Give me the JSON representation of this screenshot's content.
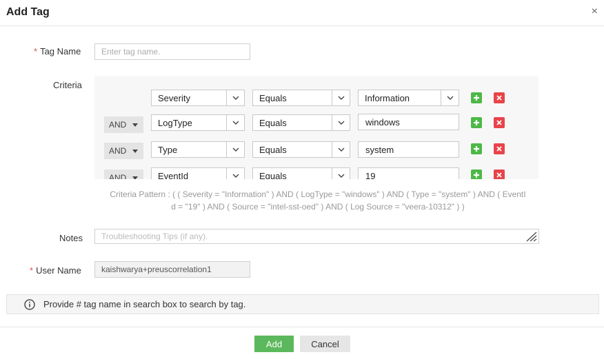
{
  "dialog": {
    "title": "Add Tag",
    "close_icon": "close-icon",
    "close_glyph": "×"
  },
  "tag_name": {
    "required_mark": "*",
    "label": "Tag Name",
    "placeholder": "Enter tag name."
  },
  "criteria": {
    "label": "Criteria",
    "rows": [
      {
        "connector": "",
        "field": "Severity",
        "operator": "Equals",
        "value": "Information",
        "value_type": "select"
      },
      {
        "connector": "AND",
        "field": "LogType",
        "operator": "Equals",
        "value": "windows",
        "value_type": "text"
      },
      {
        "connector": "AND",
        "field": "Type",
        "operator": "Equals",
        "value": "system",
        "value_type": "text"
      },
      {
        "connector": "AND",
        "field": "EventId",
        "operator": "Equals",
        "value": "19",
        "value_type": "text"
      }
    ],
    "pattern_line1": "Criteria Pattern : ( ( Severity = \"Information\" ) AND ( LogType = \"windows\" ) AND ( Type = \"system\" ) AND ( EventI",
    "pattern_line2": "d = \"19\" ) AND ( Source = \"intel-sst-oed\" ) AND ( Log Source = \"veera-10312\" ) )"
  },
  "notes": {
    "label": "Notes",
    "placeholder": "Troubleshooting Tips (if any)."
  },
  "user_name": {
    "required_mark": "*",
    "label": "User Name",
    "value": "kaishwarya+preuscorrelation1"
  },
  "info": {
    "icon": "info-circle-icon",
    "text": "Provide # tag name in search box to search by tag."
  },
  "buttons": {
    "add_label": "Add",
    "cancel_label": "Cancel"
  },
  "colors": {
    "add_green": "#5cb85c",
    "plus_green": "#4db848",
    "remove_red": "#e8444a",
    "required_red": "#d9534f"
  }
}
